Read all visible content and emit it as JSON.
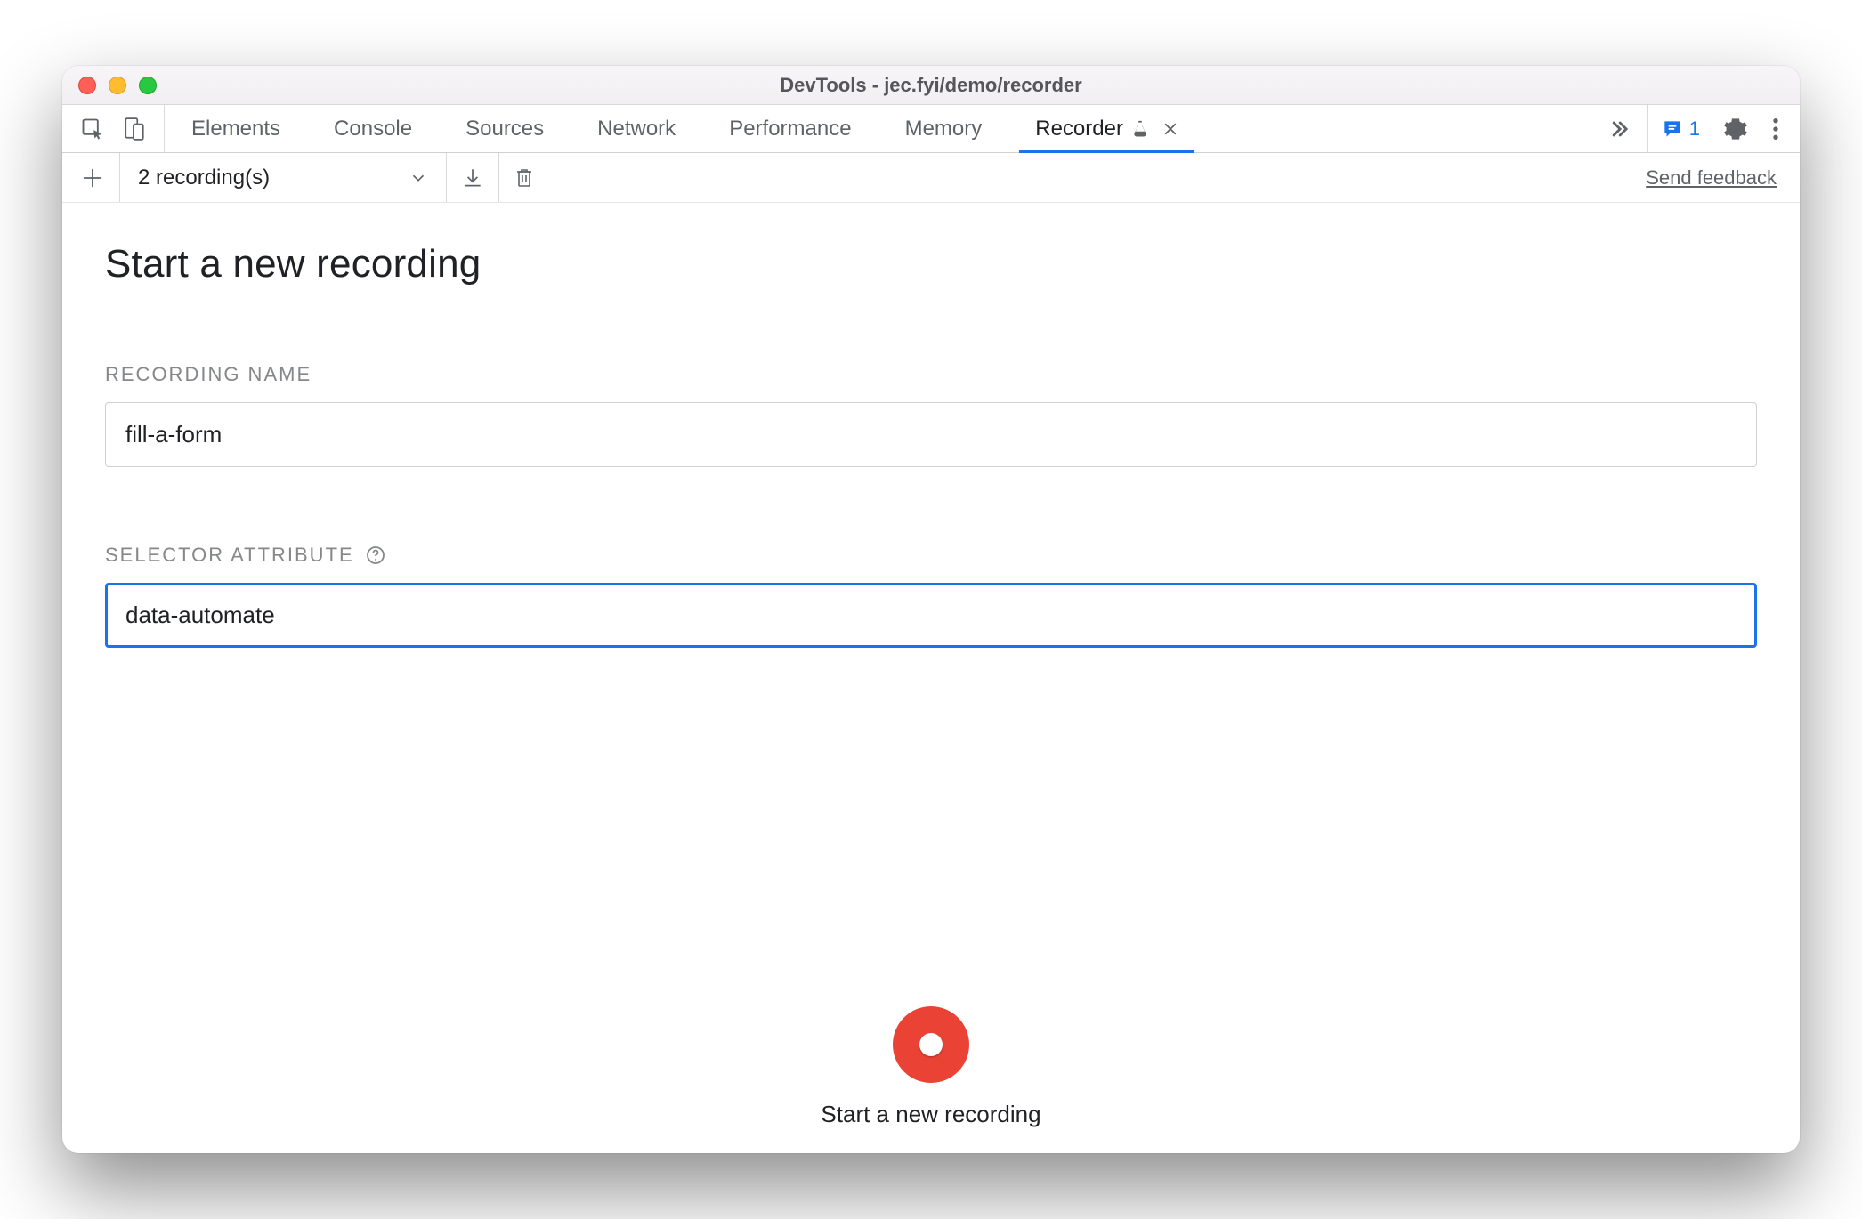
{
  "window": {
    "title": "DevTools - jec.fyi/demo/recorder"
  },
  "tabs": [
    {
      "label": "Elements",
      "active": false
    },
    {
      "label": "Console",
      "active": false
    },
    {
      "label": "Sources",
      "active": false
    },
    {
      "label": "Network",
      "active": false
    },
    {
      "label": "Performance",
      "active": false
    },
    {
      "label": "Memory",
      "active": false
    },
    {
      "label": "Recorder",
      "active": true,
      "experimental": true,
      "closable": true
    }
  ],
  "issues": {
    "count": "1"
  },
  "toolbar": {
    "recording_selector": "2 recording(s)",
    "feedback_label": "Send feedback"
  },
  "main": {
    "heading": "Start a new recording",
    "recording_name_label": "Recording Name",
    "recording_name_value": "fill-a-form",
    "selector_attr_label": "Selector Attribute",
    "selector_attr_value": "data-automate"
  },
  "footer": {
    "record_label": "Start a new recording"
  }
}
